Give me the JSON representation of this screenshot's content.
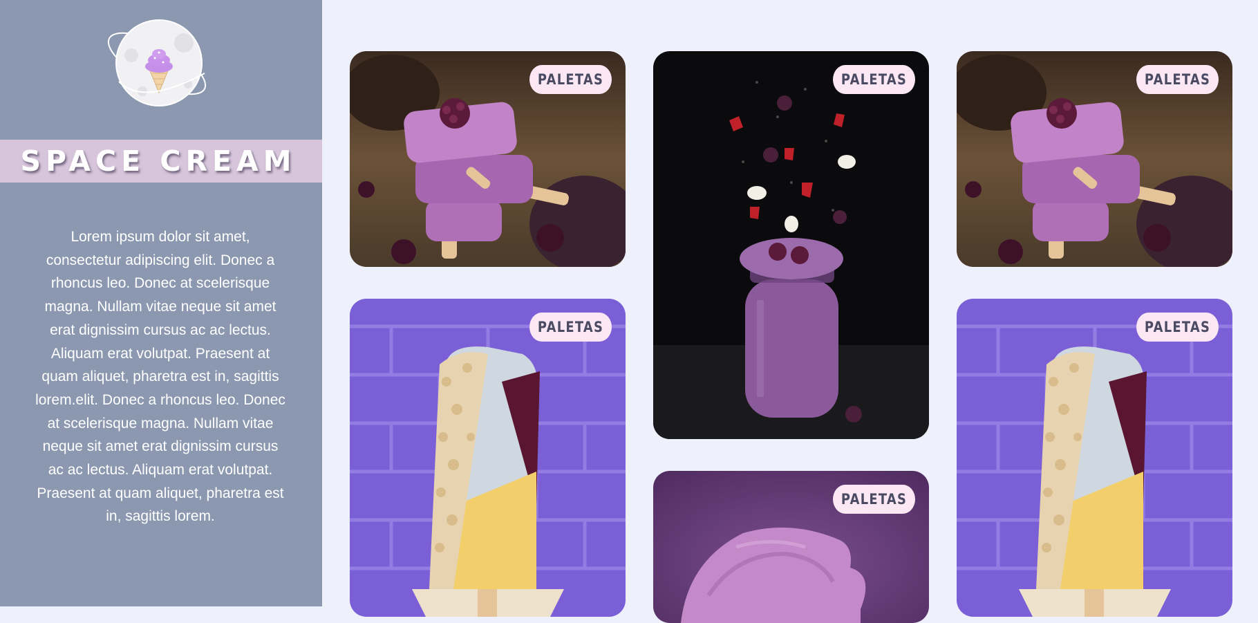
{
  "brand": {
    "title": "SPACE CREAM",
    "logo_icon": "ice-cream-planet-logo"
  },
  "sidebar": {
    "description": "Lorem ipsum dolor sit amet, consectetur adipiscing elit. Donec a rhoncus leo. Donec at scelerisque magna. Nullam vitae neque sit amet erat dignissim cursus ac ac lectus. Aliquam erat volutpat. Praesent at quam aliquet, pharetra est in, sagittis lorem.elit. Donec a rhoncus leo. Donec at scelerisque magna. Nullam vitae neque sit amet erat dignissim cursus ac ac lectus. Aliquam erat volutpat. Praesent at quam aliquet, pharetra est in, sagittis lorem."
  },
  "gallery": {
    "cards": [
      {
        "badge": "PALETAS",
        "image": "stacked-blackberry-popsicles"
      },
      {
        "badge": "PALETAS",
        "image": "berry-smoothie-jar-falling-fruit"
      },
      {
        "badge": "PALETAS",
        "image": "stacked-blackberry-popsicles"
      },
      {
        "badge": "PALETAS",
        "image": "nut-coated-popsicle-purple-brick"
      },
      {
        "badge": "PALETAS",
        "image": "purple-ice-cream-scoop"
      },
      {
        "badge": "PALETAS",
        "image": "nut-coated-popsicle-purple-brick"
      }
    ]
  },
  "colors": {
    "sidebar_bg": "#8b98af",
    "brand_band": "#d7c5db",
    "page_bg": "#eef0fc",
    "badge_bg": "#fce8f4",
    "badge_text": "#4a4a63"
  }
}
